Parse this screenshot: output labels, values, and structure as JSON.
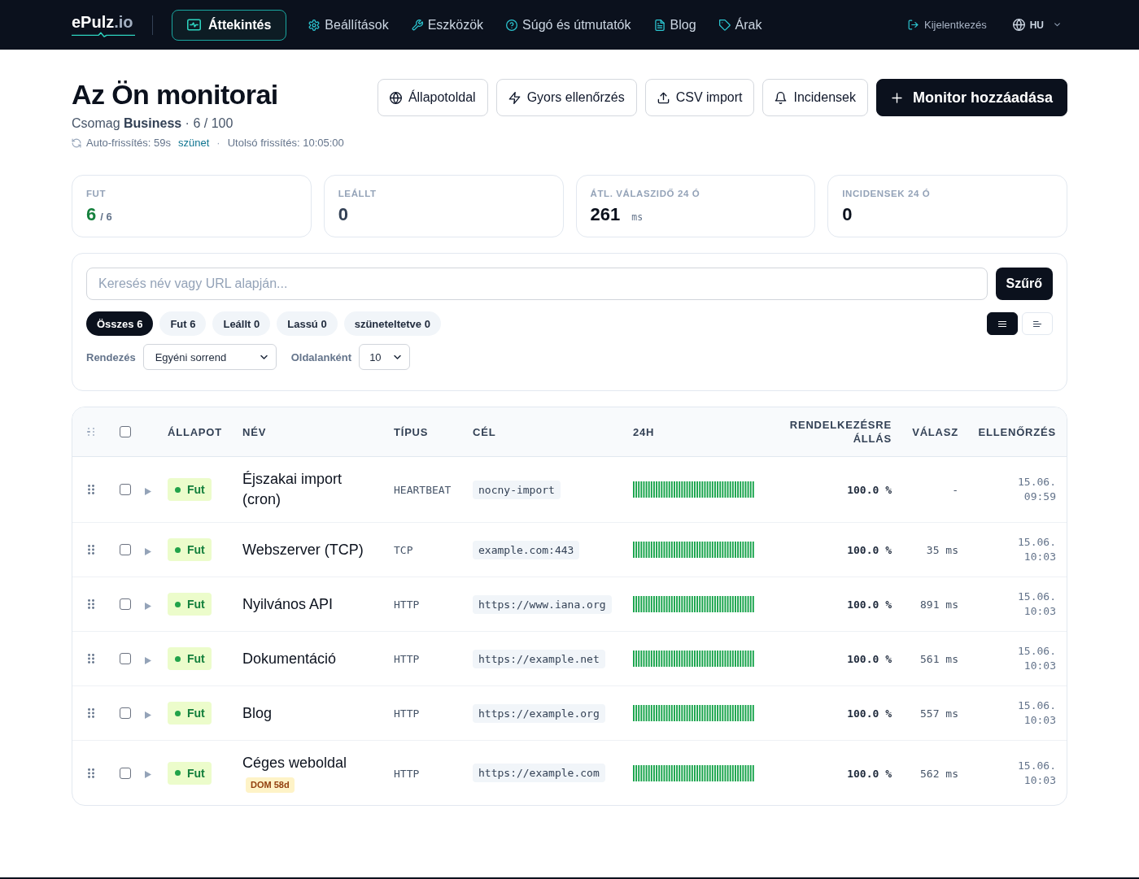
{
  "nav": {
    "logo": {
      "name": "ePulz",
      "suffix": ".io"
    },
    "items": [
      {
        "label": "Áttekintés",
        "selected": true
      },
      {
        "label": "Beállítások",
        "selected": false
      },
      {
        "label": "Eszközök",
        "selected": false
      },
      {
        "label": "Súgó és útmutatók",
        "selected": false
      },
      {
        "label": "Blog",
        "selected": false
      },
      {
        "label": "Árak",
        "selected": false
      }
    ],
    "logout": "Kijelentkezés",
    "language": "HU"
  },
  "header": {
    "title": "Az Ön monitorai",
    "plan": "Csomag **Business** · 6 / 100",
    "auto_refresh": "Auto-frissítés: 59s",
    "pause": "szünet",
    "separator": "·",
    "last_refresh": "Utolsó frissítés: 10:05:00",
    "actions": [
      {
        "label": "Állapotoldal",
        "kind": "secondary"
      },
      {
        "label": "Gyors ellenőrzés",
        "kind": "secondary"
      },
      {
        "label": "CSV import",
        "kind": "secondary"
      },
      {
        "label": "Incidensek",
        "kind": "secondary"
      },
      {
        "label": "Monitor hozzáadása",
        "kind": "primary"
      }
    ]
  },
  "stats": [
    {
      "label": "FUT",
      "value": "6",
      "total": "/ 6",
      "color": "#15803d"
    },
    {
      "label": "LEÁLLT",
      "value": "0",
      "color": "#334155"
    },
    {
      "label": "ÁTL. VÁLASZIDŐ 24 Ó",
      "value": "261",
      "unit": "ms",
      "color": "#0b111d"
    },
    {
      "label": "INCIDENSEK 24 Ó",
      "value": "0",
      "color": "#0b111d"
    }
  ],
  "filters": {
    "search": {
      "placeholder": "Keresés név vagy URL alapján..."
    },
    "submit": "Szűrő",
    "chips": [
      {
        "label": "Összes 6",
        "selected": true
      },
      {
        "label": "Fut 6",
        "selected": false
      },
      {
        "label": "Leállt 0",
        "selected": false
      },
      {
        "label": "Lassú 0",
        "selected": false
      },
      {
        "label": "szüneteltetve 0",
        "selected": false
      }
    ],
    "views": [
      {
        "selected": true
      },
      {
        "selected": false
      }
    ],
    "sort": {
      "label": "Rendezés",
      "value": "Egyéni sorrend"
    },
    "per_page": {
      "label": "Oldalanként",
      "value": "10"
    }
  },
  "table": {
    "select_all": {
      "checked": false
    },
    "columns": [
      "ÁLLAPOT",
      "NÉV",
      "TÍPUS",
      "CÉL",
      "24H",
      "RENDELKEZÉSRE ÁLLÁS",
      "VÁLASZ",
      "ELLENŐRZÉS"
    ],
    "rows": [
      {
        "checked": false,
        "expanded": false,
        "running": true,
        "status_label": "Fut",
        "name": "Éjszakai import (cron)",
        "type": "HEARTBEAT",
        "target": "nocny-import",
        "availability": "100.0 %",
        "response": "-",
        "last_check": "15.06. 09:59"
      },
      {
        "checked": false,
        "expanded": false,
        "running": true,
        "status_label": "Fut",
        "name": "Webszerver (TCP)",
        "type": "TCP",
        "target": "example.com:443",
        "availability": "100.0 %",
        "response": "35 ms",
        "last_check": "15.06. 10:03"
      },
      {
        "checked": false,
        "expanded": false,
        "running": true,
        "status_label": "Fut",
        "name": "Nyilvános API",
        "type": "HTTP",
        "target": "https://www.iana.org",
        "availability": "100.0 %",
        "response": "891 ms",
        "last_check": "15.06. 10:03"
      },
      {
        "checked": false,
        "expanded": false,
        "running": true,
        "status_label": "Fut",
        "name": "Dokumentáció",
        "type": "HTTP",
        "target": "https://example.net",
        "availability": "100.0 %",
        "response": "561 ms",
        "last_check": "15.06. 10:03"
      },
      {
        "checked": false,
        "expanded": false,
        "running": true,
        "status_label": "Fut",
        "name": "Blog",
        "type": "HTTP",
        "target": "https://example.org",
        "availability": "100.0 %",
        "response": "557 ms",
        "last_check": "15.06. 10:03"
      },
      {
        "checked": false,
        "expanded": false,
        "running": true,
        "status_label": "Fut",
        "name": "Céges weboldal",
        "badge": "DOM 58d",
        "type": "HTTP",
        "target": "https://example.com",
        "availability": "100.0 %",
        "response": "562 ms",
        "last_check": "15.06. 10:03"
      }
    ]
  }
}
